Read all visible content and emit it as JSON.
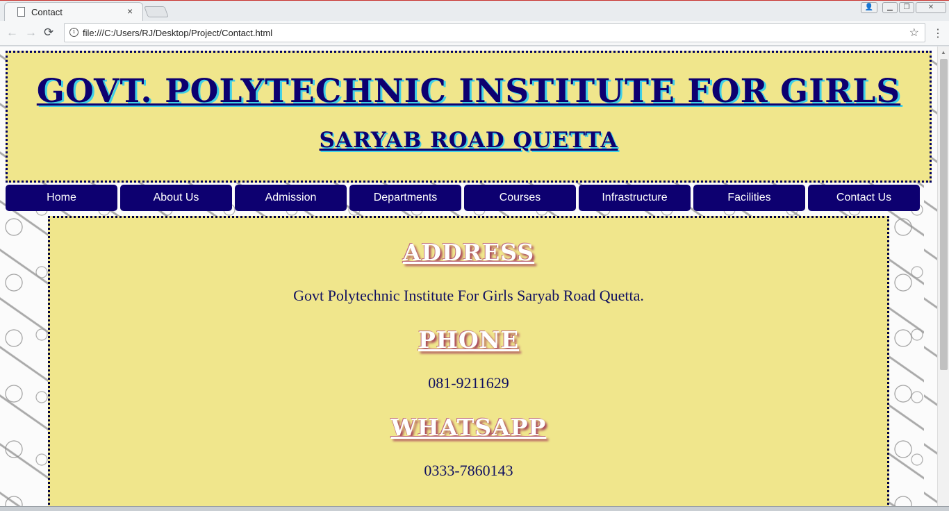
{
  "browser": {
    "tab_title": "Contact",
    "tab_close": "×",
    "url": "file:///C:/Users/RJ/Desktop/Project/Contact.html",
    "icons": {
      "back": "back-arrow-icon",
      "forward": "forward-arrow-icon",
      "reload": "reload-icon",
      "info": "info-icon",
      "star": "star-icon",
      "menu": "menu-icon"
    },
    "glyphs": {
      "back": "←",
      "forward": "→",
      "reload": "⟳",
      "info": "i",
      "star": "☆",
      "menu": "⋮",
      "user": "👤",
      "minimize": "▁",
      "restore": "❐",
      "close": "✕",
      "scroll_up": "▲"
    }
  },
  "header": {
    "title": "GOVT. POLYTECHNIC INSTITUTE FOR GIRLS",
    "subtitle": "SARYAB ROAD QUETTA"
  },
  "nav": {
    "items": [
      {
        "label": "Home"
      },
      {
        "label": "About Us"
      },
      {
        "label": "Admission"
      },
      {
        "label": "Departments"
      },
      {
        "label": "Courses"
      },
      {
        "label": "Infrastructure"
      },
      {
        "label": "Facilities"
      },
      {
        "label": "Contact Us"
      }
    ]
  },
  "contact": {
    "address_heading": "ADDRESS",
    "address": "Govt Polytechnic Institute For Girls Saryab Road Quetta.",
    "phone_heading": "PHONE",
    "phone": "081-9211629",
    "whatsapp_heading": "WHATSAPP",
    "whatsapp": "0333-7860143"
  },
  "colors": {
    "panel": "#f0e68c",
    "navy": "#0d0070",
    "title_shadow": "#3fd0e6",
    "heading_shadow": "#a8485a"
  }
}
